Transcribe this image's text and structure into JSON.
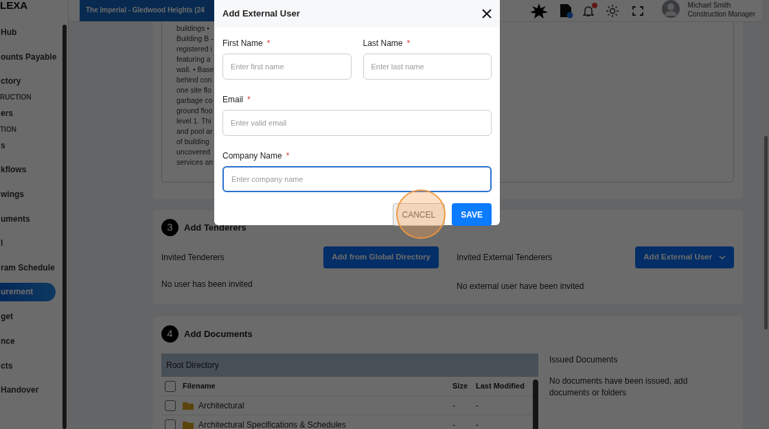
{
  "sidebar": {
    "logo": "LEXA",
    "items": [
      {
        "label": "Hub",
        "kind": "link",
        "selected": false
      },
      {
        "label": "ounts Payable",
        "kind": "link",
        "selected": false
      },
      {
        "label": "ctory",
        "kind": "link",
        "selected": false
      },
      {
        "label": "RUCTION",
        "kind": "section"
      },
      {
        "label": "ers",
        "kind": "link",
        "selected": false
      },
      {
        "label": "TION",
        "kind": "section"
      },
      {
        "label": "s",
        "kind": "link",
        "selected": false
      },
      {
        "label": "kflows",
        "kind": "link",
        "selected": false
      },
      {
        "label": "wings",
        "kind": "link",
        "selected": false
      },
      {
        "label": "uments",
        "kind": "link",
        "selected": false
      },
      {
        "label": "l",
        "kind": "link",
        "selected": false
      },
      {
        "label": "ram Schedule",
        "kind": "link",
        "selected": false
      },
      {
        "label": "urement",
        "kind": "link",
        "selected": true
      },
      {
        "label": "get",
        "kind": "link",
        "selected": false
      },
      {
        "label": "nce",
        "kind": "link",
        "selected": false
      },
      {
        "label": "cts",
        "kind": "link",
        "selected": false
      },
      {
        "label": "Handover",
        "kind": "link",
        "selected": false
      }
    ]
  },
  "header": {
    "project_tab": "The Imperial - Gledwood Heights (24",
    "notifications_unread": true,
    "user": {
      "name": "Michael Smith",
      "role": "Construction Manager"
    }
  },
  "description": {
    "lines": [
      "buildings •",
      "Building B -",
      "registered i",
      "featuring a",
      "wall. • Base",
      "behind con",
      "one site flo",
      "garbage co",
      "ground floo",
      "level 1. Thi",
      "and pool ar",
      "of building",
      "uncovered",
      "services an"
    ]
  },
  "tenderers": {
    "number": "3",
    "title": "Add Tenderers",
    "columns": [
      {
        "label": "Invited Tenderers",
        "button": "Add from Global Directory",
        "dropdown": false,
        "empty": "No user has been invited"
      },
      {
        "label": "Invited External Tenderers",
        "button": "Add External User",
        "dropdown": true,
        "empty": "No external user have been invited"
      }
    ]
  },
  "documents": {
    "number": "4",
    "title": "Add Documents",
    "directory": "Root Directory",
    "columns": [
      "Filename",
      "Size",
      "Last Modified"
    ],
    "all_checked": false,
    "rows": [
      {
        "name": "Architectural",
        "size": "-",
        "modified": "-",
        "checked": false
      },
      {
        "name": "Architectural Specifications & Schedules",
        "size": "-",
        "modified": "-",
        "checked": false
      }
    ],
    "issued_title": "Issued Documents",
    "issued_empty": "No documents have been issued, add documents or folders"
  },
  "modal": {
    "title": "Add External User",
    "rows": [
      [
        {
          "label": "First Name",
          "required_mark": "*",
          "placeholder": "Enter first name",
          "focused": false
        },
        {
          "label": "Last Name",
          "required_mark": "*",
          "placeholder": "Enter last name",
          "focused": false
        }
      ],
      [
        {
          "label": "Email",
          "required_mark": "*",
          "placeholder": "Enter valid email",
          "focused": false
        }
      ],
      [
        {
          "label": "Company Name",
          "required_mark": "*",
          "placeholder": "Enter company name",
          "focused": true
        }
      ]
    ],
    "actions": [
      {
        "label": "CANCEL",
        "kind": "secondary",
        "pressed": true
      },
      {
        "label": "SAVE",
        "kind": "primary",
        "pressed": false
      }
    ]
  }
}
